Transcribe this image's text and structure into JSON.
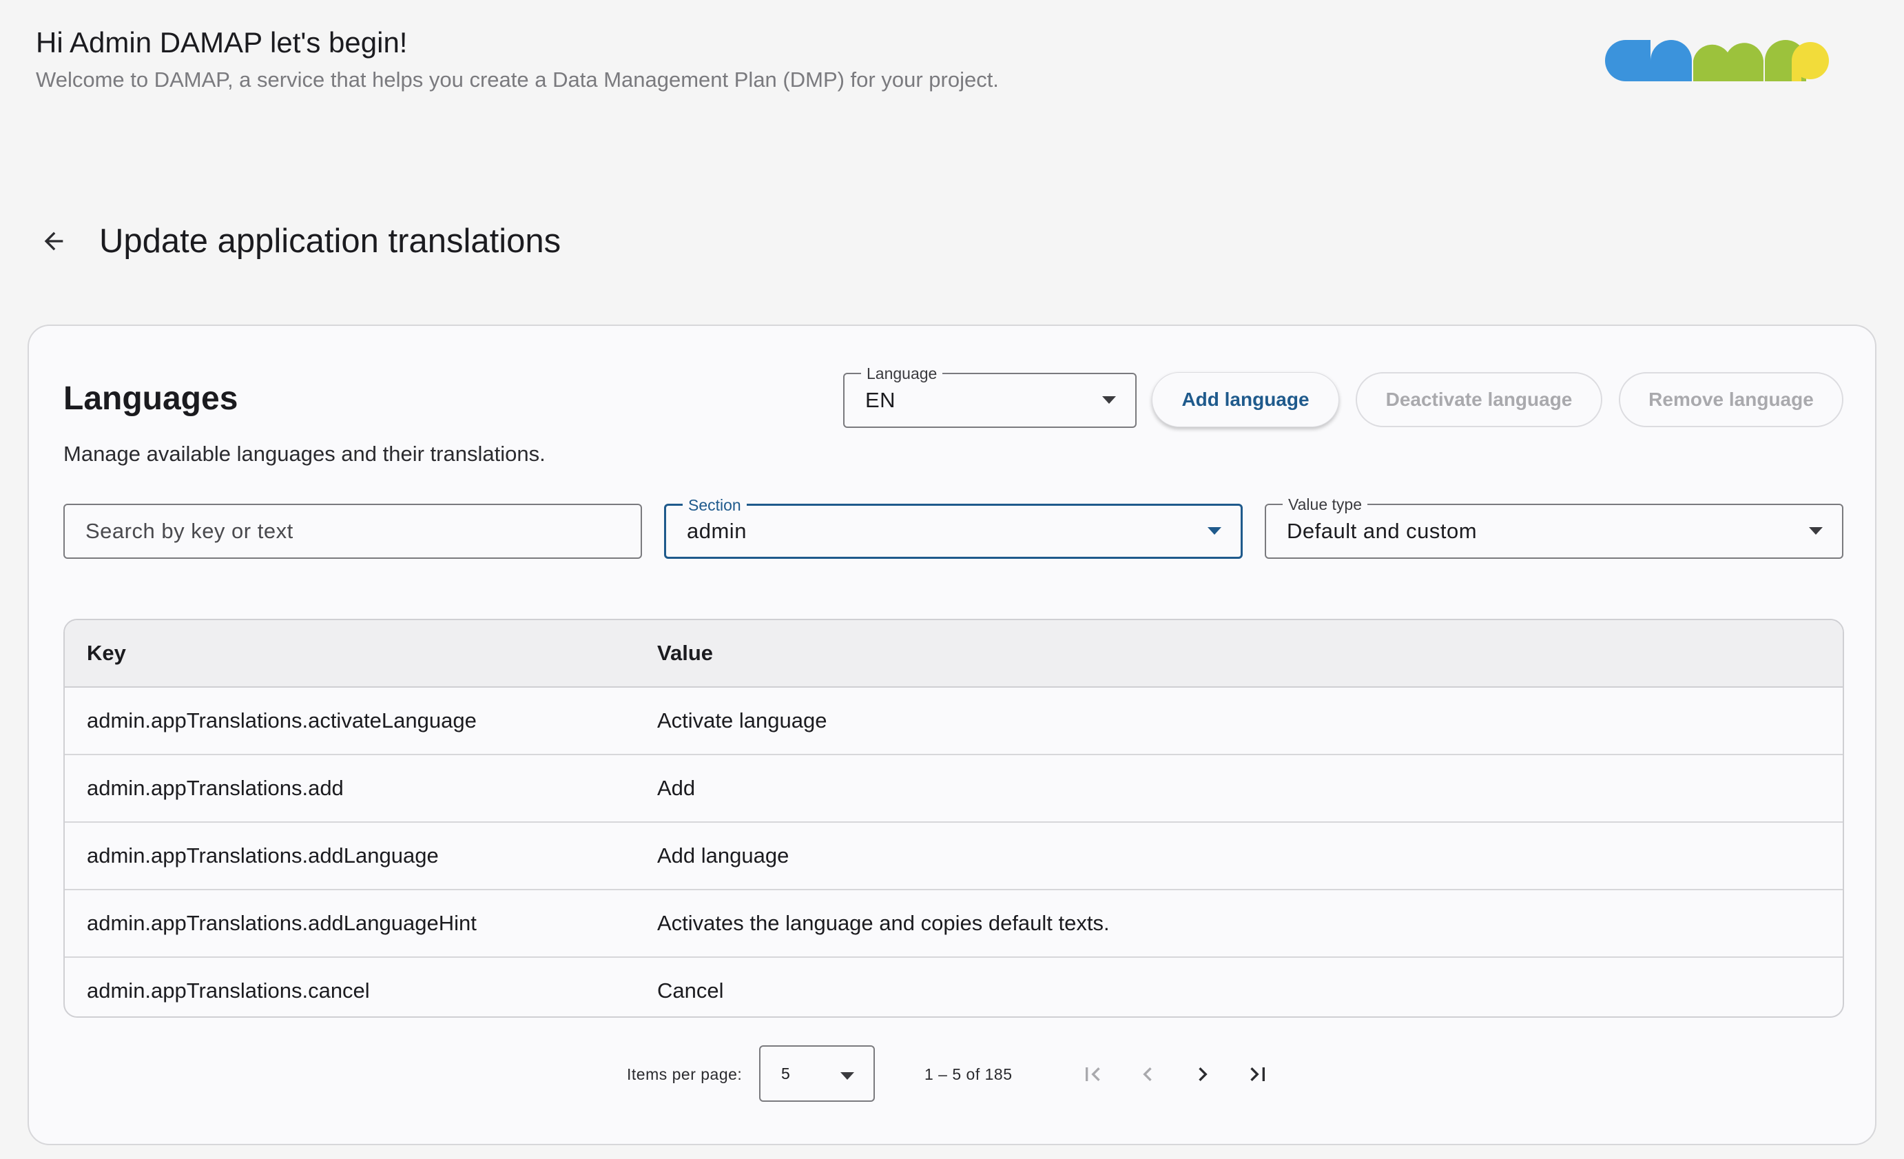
{
  "header": {
    "greeting": "Hi Admin DAMAP let's begin!",
    "welcome": "Welcome to DAMAP, a service that helps you create a Data Management Plan (DMP) for your project.",
    "logo_alt": "damap"
  },
  "page": {
    "title": "Update application translations",
    "back_icon": "arrow-left-icon"
  },
  "card": {
    "title": "Languages",
    "subtitle": "Manage available languages and their translations."
  },
  "language_select": {
    "label": "Language",
    "value": "EN"
  },
  "buttons": {
    "add": "Add language",
    "deactivate": "Deactivate language",
    "remove": "Remove language"
  },
  "filters": {
    "search_placeholder": "Search by key or text",
    "section": {
      "label": "Section",
      "value": "admin"
    },
    "value_type": {
      "label": "Value type",
      "value": "Default and custom"
    }
  },
  "table": {
    "headers": {
      "key": "Key",
      "value": "Value"
    },
    "rows": [
      {
        "key": "admin.appTranslations.activateLanguage",
        "value": "Activate language"
      },
      {
        "key": "admin.appTranslations.add",
        "value": "Add"
      },
      {
        "key": "admin.appTranslations.addLanguage",
        "value": "Add language"
      },
      {
        "key": "admin.appTranslations.addLanguageHint",
        "value": "Activates the language and copies default texts."
      },
      {
        "key": "admin.appTranslations.cancel",
        "value": "Cancel"
      }
    ]
  },
  "paginator": {
    "items_per_page_label": "Items per page:",
    "items_per_page": "5",
    "range": "1 – 5 of 185"
  },
  "colors": {
    "primary": "#1f5a8c",
    "logo_blue": "#3b93dc",
    "logo_green": "#9cc23c",
    "logo_yellow": "#f2dc3a"
  }
}
